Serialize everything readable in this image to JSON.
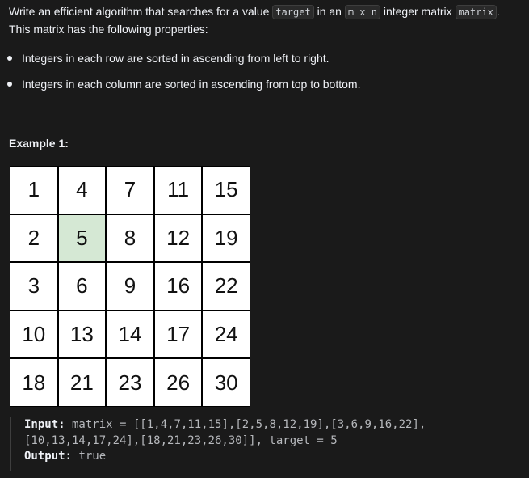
{
  "description": {
    "part1": "Write an efficient algorithm that searches for a value ",
    "code_target": "target",
    "part2": " in an ",
    "code_mxn": "m x n",
    "part3": " integer matrix ",
    "code_matrix": "matrix",
    "part4": ". This matrix has the following properties:"
  },
  "properties": [
    "Integers in each row are sorted in ascending from left to right.",
    "Integers in each column are sorted in ascending from top to bottom."
  ],
  "example": {
    "title": "Example 1:",
    "matrix": [
      [
        "1",
        "4",
        "7",
        "11",
        "15"
      ],
      [
        "2",
        "5",
        "8",
        "12",
        "19"
      ],
      [
        "3",
        "6",
        "9",
        "16",
        "22"
      ],
      [
        "10",
        "13",
        "14",
        "17",
        "24"
      ],
      [
        "18",
        "21",
        "23",
        "26",
        "30"
      ]
    ],
    "highlight_row": 1,
    "highlight_col": 1,
    "highlight_color": "#d5e8d4",
    "input_label": "Input:",
    "input_line1": " matrix = [[1,4,7,11,15],[2,5,8,12,19],[3,6,9,16,22],",
    "input_line2": "[10,13,14,17,24],[18,21,23,26,30]], target = 5",
    "output_label": "Output:",
    "output_value": " true"
  }
}
